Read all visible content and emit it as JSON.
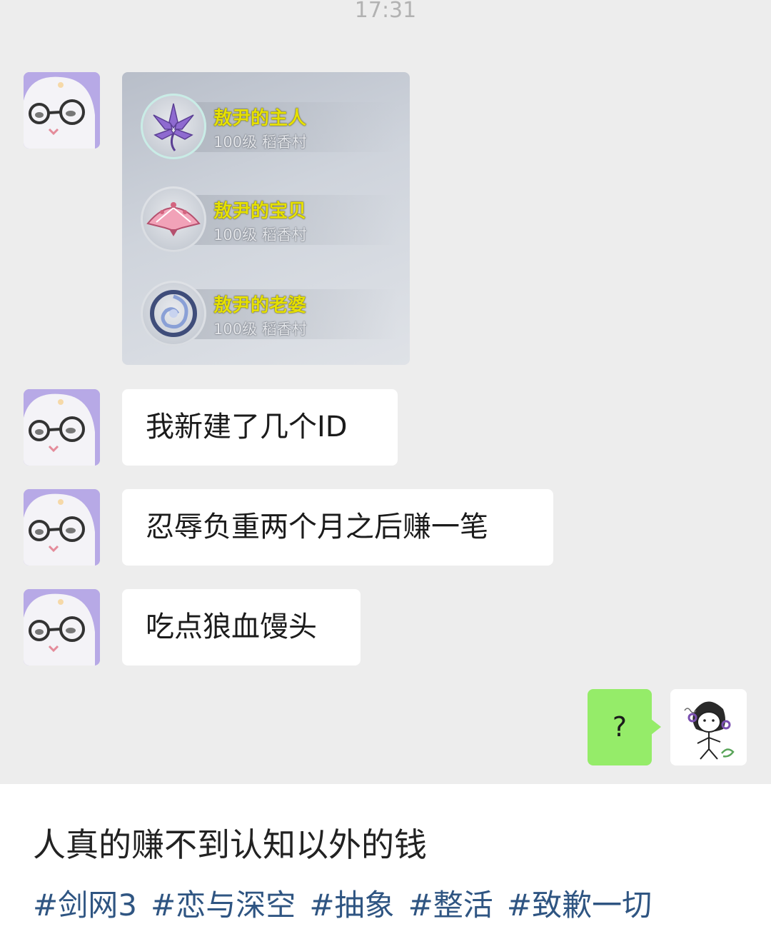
{
  "status_bar": {
    "time": "17:31"
  },
  "conversation": {
    "game_screenshot": {
      "characters": [
        {
          "name": "敖尹的主人",
          "info": "100级 稻香村",
          "emblem_icon": "lotus-emblem-icon"
        },
        {
          "name": "敖尹的宝贝",
          "info": "100级 稻香村",
          "emblem_icon": "fan-emblem-icon"
        },
        {
          "name": "敖尹的老婆",
          "info": "100级 稻香村",
          "emblem_icon": "swirl-emblem-icon"
        }
      ]
    },
    "messages": [
      {
        "text": "我新建了几个ID"
      },
      {
        "text": "忍辱负重两个月之后赚一笔"
      },
      {
        "text": "吃点狼血馒头"
      }
    ],
    "reply": {
      "text": "?"
    }
  },
  "post": {
    "caption": "人真的赚不到认知以外的钱",
    "tags": [
      "#剑网3",
      "#恋与深空",
      "#抽象",
      "#整活",
      "#致歉一切"
    ]
  },
  "colors": {
    "chat_background": "#ededed",
    "incoming_bubble": "#ffffff",
    "outgoing_bubble": "#95ec69",
    "avatar_purple": "#b7a9e6",
    "character_name": "#e6e000",
    "tag_link": "#2f5582"
  }
}
